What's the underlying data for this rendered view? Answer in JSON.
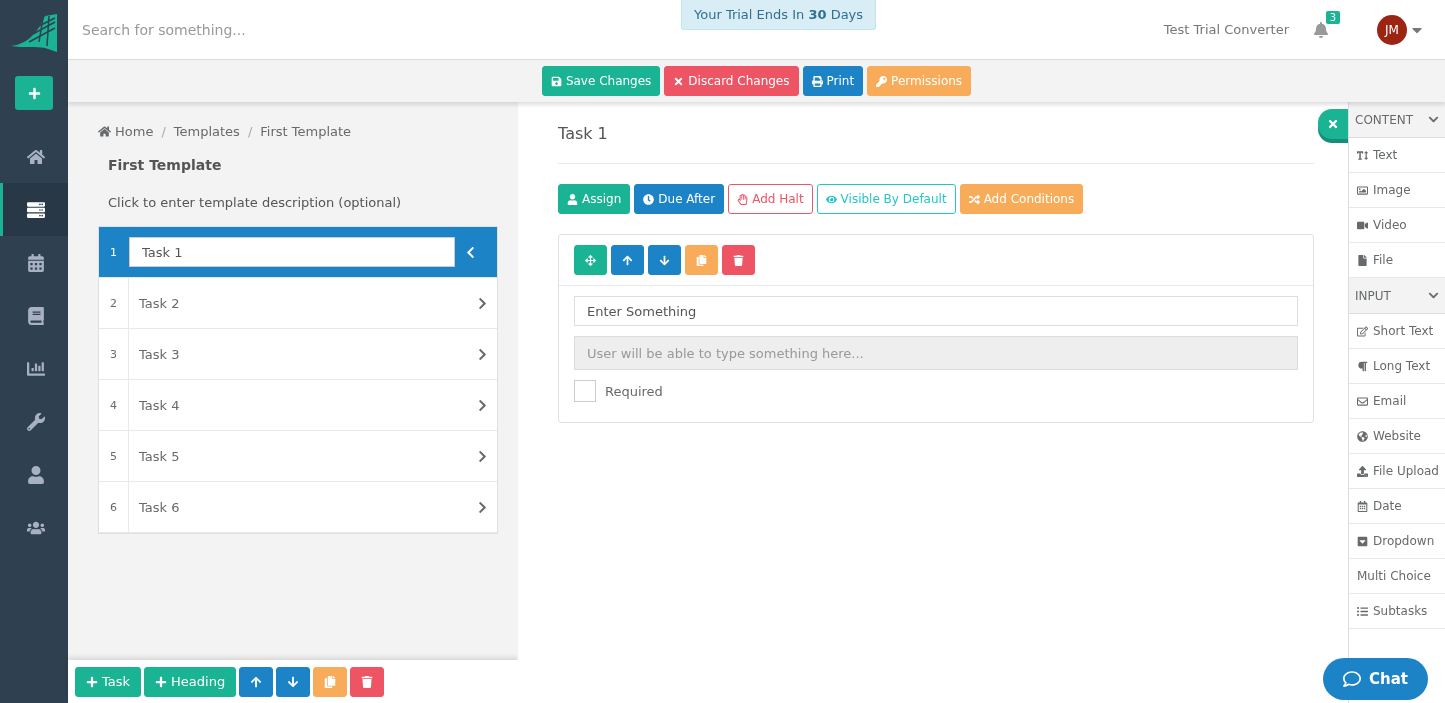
{
  "trial_banner": "Your Trial Ends In **30** Days",
  "search": {
    "placeholder": "Search for something..."
  },
  "user": {
    "name": "Test Trial Converter",
    "notifications": "3",
    "initials": "JM"
  },
  "nav": [
    {
      "selected": false
    },
    {
      "selected": true
    },
    {
      "selected": false
    },
    {
      "selected": false
    },
    {
      "selected": false
    },
    {
      "selected": false
    },
    {
      "selected": false
    },
    {
      "selected": false
    }
  ],
  "toolbar": [
    {
      "label": "Save Changes",
      "kind": "success"
    },
    {
      "label": "Discard Changes",
      "kind": "danger"
    },
    {
      "label": "Print",
      "kind": "primary"
    },
    {
      "label": "Permissions",
      "kind": "warning"
    }
  ],
  "breadcrumb": {
    "separator": "/",
    "items": [
      "Home",
      "Templates",
      "First Template"
    ]
  },
  "template": {
    "title": "First Template",
    "description": "Click to enter template description (optional)"
  },
  "tasks": [
    {
      "number": "1",
      "name": "Task 1",
      "selected": true
    },
    {
      "number": "2",
      "name": "Task 2",
      "selected": false
    },
    {
      "number": "3",
      "name": "Task 3",
      "selected": false
    },
    {
      "number": "4",
      "name": "Task 4",
      "selected": false
    },
    {
      "number": "5",
      "name": "Task 5",
      "selected": false
    },
    {
      "number": "6",
      "name": "Task 6",
      "selected": false
    }
  ],
  "bottom_toolbar": [
    {
      "label": "Task",
      "kind": "success"
    },
    {
      "label": "Heading",
      "kind": "success"
    },
    {
      "kind": "primary"
    },
    {
      "kind": "primary"
    },
    {
      "kind": "warning"
    },
    {
      "kind": "danger"
    }
  ],
  "task": {
    "title": "Task 1",
    "actions": [
      {
        "label": "Assign",
        "kind": "success"
      },
      {
        "label": "Due After",
        "kind": "primary"
      },
      {
        "label": "Add Halt",
        "kind": "outline-danger"
      },
      {
        "label": "Visible By Default",
        "kind": "outline-info"
      },
      {
        "label": "Add Conditions",
        "kind": "warning"
      }
    ],
    "block_tools": [
      {
        "kind": "success"
      },
      {
        "kind": "primary"
      },
      {
        "kind": "primary"
      },
      {
        "kind": "warning"
      },
      {
        "kind": "danger"
      }
    ],
    "label_value": "Enter Something",
    "answer_placeholder": "User will be able to type something here...",
    "required": {
      "label": "Required",
      "checked": false
    }
  },
  "palette": [
    {
      "heading": "CONTENT",
      "items": [
        "Text",
        "Image",
        "Video",
        "File"
      ]
    },
    {
      "heading": "INPUT",
      "items": [
        "Short Text",
        "Long Text",
        "Email",
        "Website",
        "File Upload",
        "Date",
        "Dropdown",
        "Multi Choice",
        "Subtasks"
      ]
    }
  ],
  "chat": "Chat"
}
